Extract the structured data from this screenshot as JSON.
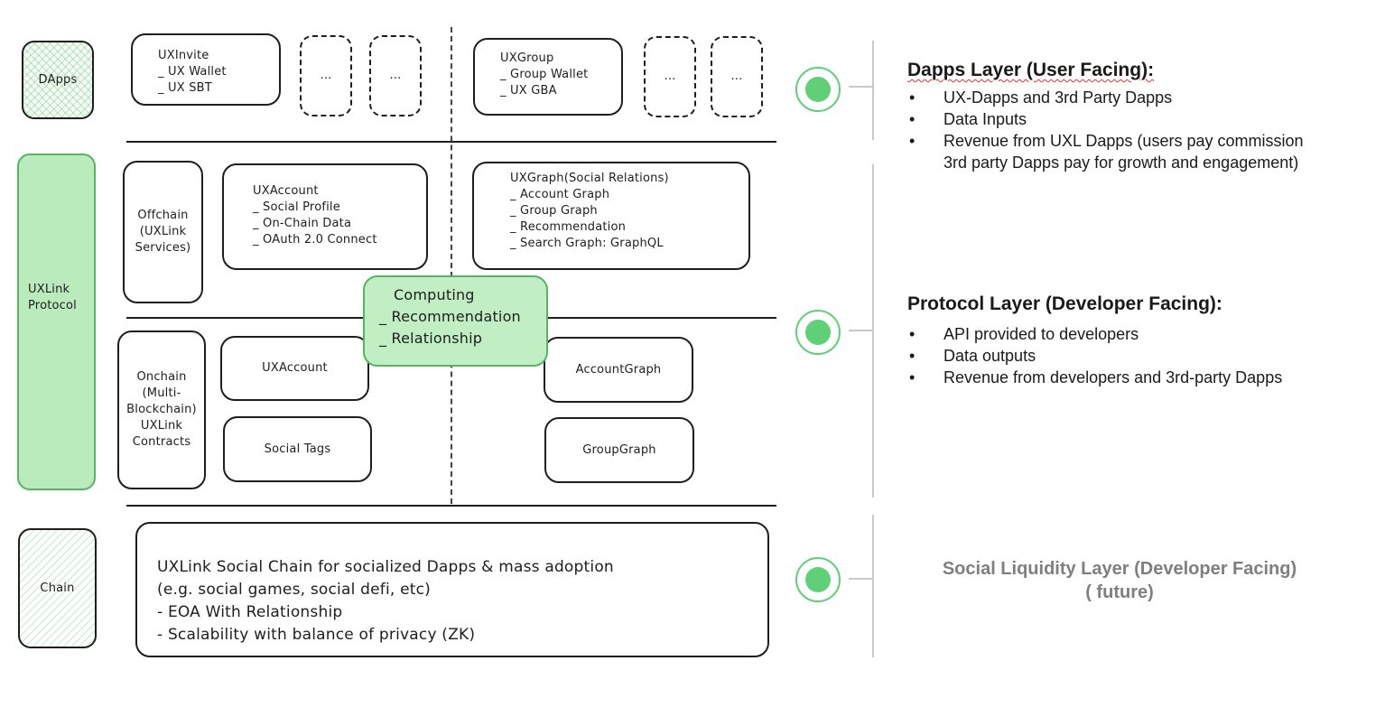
{
  "diagram": {
    "left_tags": {
      "dapps": "DApps",
      "protocol": "UXLink Protocol",
      "chain": "Chain"
    },
    "dapps_row": {
      "uxinvite": {
        "title": "UXInvite",
        "items": [
          "UX Wallet",
          "UX SBT"
        ]
      },
      "placeholder_1": "...",
      "placeholder_2": "...",
      "uxgroup": {
        "title": "UXGroup",
        "items": [
          "Group Wallet",
          "UX GBA"
        ]
      },
      "placeholder_3": "...",
      "placeholder_4": "..."
    },
    "offchain_row": {
      "label": "Offchain (UXLink Services)",
      "uxaccount": {
        "title": "UXAccount",
        "items": [
          "Social Profile",
          "On-Chain Data",
          "OAuth 2.0 Connect"
        ]
      },
      "uxgraph": {
        "title": "UXGraph(Social Relations)",
        "items": [
          "Account Graph",
          "Group Graph",
          "Recommendation",
          "Search Graph: GraphQL"
        ]
      }
    },
    "computing": {
      "title": "Computing",
      "items": [
        "Recommendation",
        "Relationship"
      ]
    },
    "onchain_row": {
      "label": "Onchain (Multi-Blockchain) UXLink Contracts",
      "uxaccount": "UXAccount",
      "social_tags": "Social Tags",
      "account_graph": "AccountGraph",
      "group_graph": "GroupGraph"
    },
    "chain_row": {
      "lines": [
        "UXLink Social Chain for socialized Dapps & mass adoption",
        "(e.g. social games, social defi, etc)",
        "- EOA With Relationship",
        "- Scalability with balance of privacy (ZK)"
      ]
    }
  },
  "layers": [
    {
      "title": "Dapps Layer (User Facing):",
      "bullets": [
        "UX-Dapps and 3rd Party Dapps",
        "Data Inputs",
        "Revenue from UXL Dapps (users pay commission",
        "3rd party Dapps pay for growth and engagement)"
      ]
    },
    {
      "title": "Protocol Layer (Developer Facing):",
      "bullets": [
        "API provided to developers",
        "Data outputs",
        "Revenue from developers and 3rd-party Dapps"
      ]
    },
    {
      "title": "Social Liquidity Layer (Developer Facing)",
      "subtitle": "( future)"
    }
  ],
  "colors": {
    "accent_green": "#5fcf78",
    "protocol_fill": "#b9ebbd",
    "muted_text": "#7f7f7f"
  }
}
